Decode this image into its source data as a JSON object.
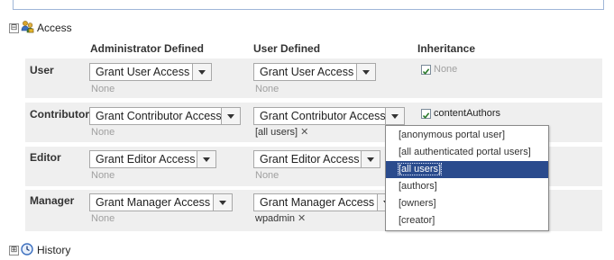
{
  "access": {
    "title": "Access",
    "toggle": "⊟",
    "columns": {
      "admin": "Administrator Defined",
      "user": "User Defined",
      "inheritance": "Inheritance"
    },
    "rows": [
      {
        "label": "User",
        "admin_select": "Grant User Access",
        "admin_value": "None",
        "user_select": "Grant User Access",
        "user_value": "None",
        "user_value_removable": false,
        "inheritance_checked": true,
        "inheritance_text": "None"
      },
      {
        "label": "Contributor",
        "admin_select": "Grant Contributor Access",
        "admin_value": "None",
        "user_select": "Grant Contributor Access",
        "user_value": "[all users]",
        "user_value_removable": true,
        "inheritance_checked": true,
        "inheritance_text": "contentAuthors"
      },
      {
        "label": "Editor",
        "admin_select": "Grant Editor Access",
        "admin_value": "None",
        "user_select": "Grant Editor Access",
        "user_value": "None",
        "user_value_removable": false
      },
      {
        "label": "Manager",
        "admin_select": "Grant Manager Access",
        "admin_value": "None",
        "user_select": "Grant Manager Access",
        "user_value": "wpadmin",
        "user_value_removable": true
      }
    ]
  },
  "dropdown": {
    "options": [
      "[anonymous portal user]",
      "[all authenticated portal users]",
      "[all users]",
      "[authors]",
      "[owners]",
      "[creator]"
    ],
    "selected_index": 2
  },
  "history": {
    "title": "History",
    "toggle": "⊞"
  },
  "colors": {
    "row_bg": "#efefef",
    "selection": "#2a4b8d",
    "muted_text": "#a0a0a0"
  }
}
